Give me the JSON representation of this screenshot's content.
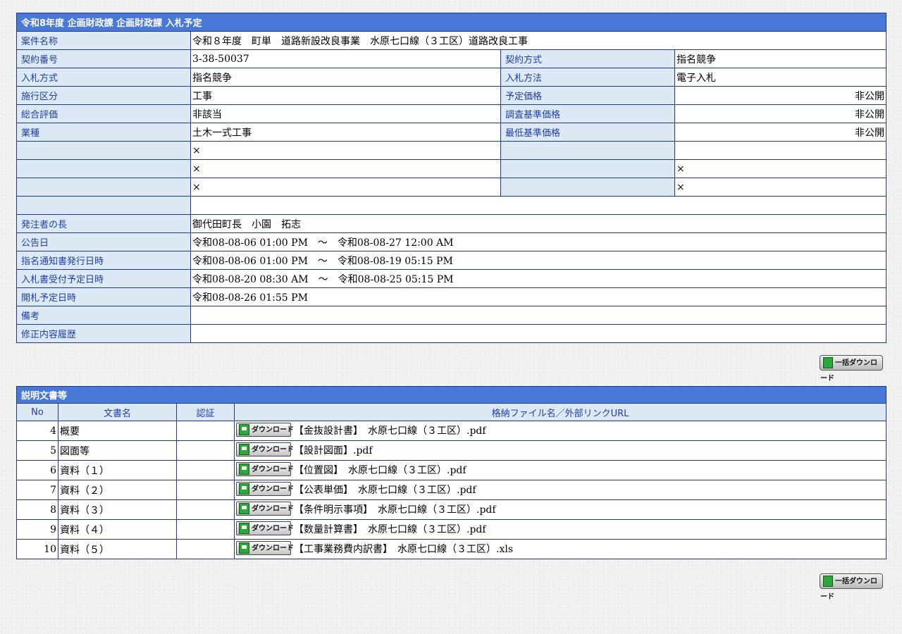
{
  "info": {
    "title": "令和8年度 企画財政課 企画財政課 入札予定",
    "case_name_label": "案件名称",
    "case_name": "令和８年度　町単　道路新設改良事業　水原七口線（３工区）道路改良工事",
    "rows": [
      {
        "l1": "契約番号",
        "v1": "3-38-50037",
        "l2": "契約方式",
        "v2": "指名競争"
      },
      {
        "l1": "入札方式",
        "v1": "指名競争",
        "l2": "入札方法",
        "v2": "電子入札"
      },
      {
        "l1": "施行区分",
        "v1": "工事",
        "l2": "予定価格",
        "v2": "非公開"
      },
      {
        "l1": "総合評価",
        "v1": "非該当",
        "l2": "調査基準価格",
        "v2": "非公開"
      },
      {
        "l1": "業種",
        "v1": "土木一式工事",
        "l2": "最低基準価格",
        "v2": "非公開"
      },
      {
        "l1": "",
        "v1": "×",
        "l2": "",
        "v2": ""
      },
      {
        "l1": "",
        "v1": "×",
        "l2": "",
        "v2": "×"
      },
      {
        "l1": "",
        "v1": "×",
        "l2": "",
        "v2": "×"
      }
    ],
    "blank_label": "",
    "blank_value": "",
    "wide_rows": [
      {
        "label": "発注者の長",
        "value": "御代田町長　小園　拓志"
      },
      {
        "label": "公告日",
        "value": "令和08-08-06 01:00 PM　～　令和08-08-27 12:00 AM"
      },
      {
        "label": "指名通知書発行日時",
        "value": "令和08-08-06 01:00 PM　～　令和08-08-19 05:15 PM"
      },
      {
        "label": "入札書受付予定日時",
        "value": "令和08-08-20 08:30 AM　～　令和08-08-25 05:15 PM"
      },
      {
        "label": "開札予定日時",
        "value": "令和08-08-26 01:55 PM"
      },
      {
        "label": "備考",
        "value": ""
      },
      {
        "label": "修正内容履歴",
        "value": ""
      }
    ]
  },
  "bulk_download_label": "一括ダウンロード",
  "docs": {
    "title": "説明文書等",
    "headers": {
      "no": "No",
      "name": "文書名",
      "cert": "認証",
      "file": "格納ファイル名／外部リンクURL"
    },
    "download_label": "ダウンロード",
    "rows": [
      {
        "no": "4",
        "name": "概要",
        "cert": "",
        "file": "【金抜設計書】　水原七口線（３工区）.pdf"
      },
      {
        "no": "5",
        "name": "図面等",
        "cert": "",
        "file": "【設計図面】.pdf"
      },
      {
        "no": "6",
        "name": "資料（１）",
        "cert": "",
        "file": "【位置図】　水原七口線（３工区）.pdf"
      },
      {
        "no": "7",
        "name": "資料（２）",
        "cert": "",
        "file": "【公表単価】　水原七口線（３工区）.pdf"
      },
      {
        "no": "8",
        "name": "資料（３）",
        "cert": "",
        "file": "【条件明示事項】　水原七口線（３工区）.pdf"
      },
      {
        "no": "9",
        "name": "資料（４）",
        "cert": "",
        "file": "【数量計算書】　水原七口線（３工区）.pdf"
      },
      {
        "no": "10",
        "name": "資料（５）",
        "cert": "",
        "file": "【工事業務費内訳書】　水原七口線（３工区）.xls"
      }
    ]
  }
}
